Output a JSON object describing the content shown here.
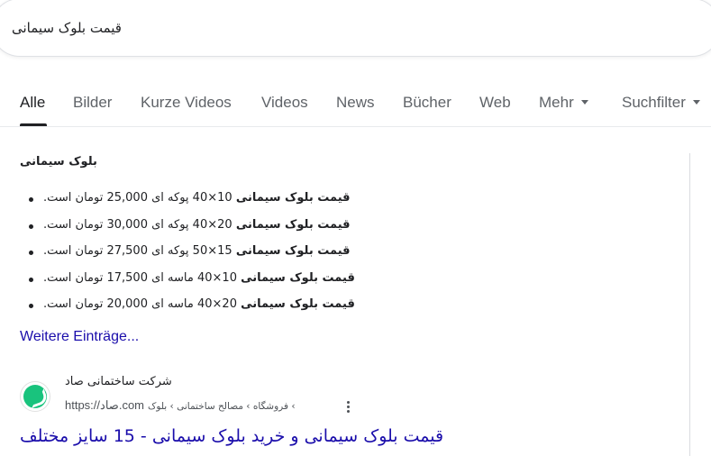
{
  "search": {
    "query": "قیمت بلوک سیمانی"
  },
  "tabs": [
    {
      "label": "Alle",
      "active": true
    },
    {
      "label": "Bilder"
    },
    {
      "label": "Kurze Videos"
    },
    {
      "label": "Videos"
    },
    {
      "label": "News"
    },
    {
      "label": "Bücher"
    },
    {
      "label": "Web"
    },
    {
      "label": "Mehr"
    },
    {
      "label": "Suchfilter"
    }
  ],
  "snippet": {
    "title": "بلوک سیمانی",
    "items": [
      {
        "bold": "قیمت بلوک سیمانی",
        "rest": " 10×40 پوکه ای 25,000 تومان است."
      },
      {
        "bold": "قیمت بلوک سیمانی",
        "rest": " 20×40 پوکه ای 30,000 تومان است."
      },
      {
        "bold": "قیمت بلوک سیمانی",
        "rest": " 15×50 پوکه ای 27,500 تومان است."
      },
      {
        "bold": "قیمت بلوک سیمانی",
        "rest": " 10×40 ماسه ای 17,500 تومان است."
      },
      {
        "bold": "قیمت بلوک سیمانی",
        "rest": " 20×40 ماسه ای 20,000 تومان است."
      }
    ],
    "more_link": "Weitere Einträge..."
  },
  "result": {
    "site_name": "شرکت ساختمانی صاد",
    "url": "https://صاد.com",
    "breadcrumb": "› فروشگاه › مصالح ساختمانی › بلوک",
    "title": "قیمت بلوک سیمانی و خرید بلوک سیمانی - 15 سایز مختلف",
    "favicon_color": "#19c37d"
  },
  "colors": {
    "link": "#1a0dab",
    "muted": "#5f6368",
    "text": "#202124"
  }
}
